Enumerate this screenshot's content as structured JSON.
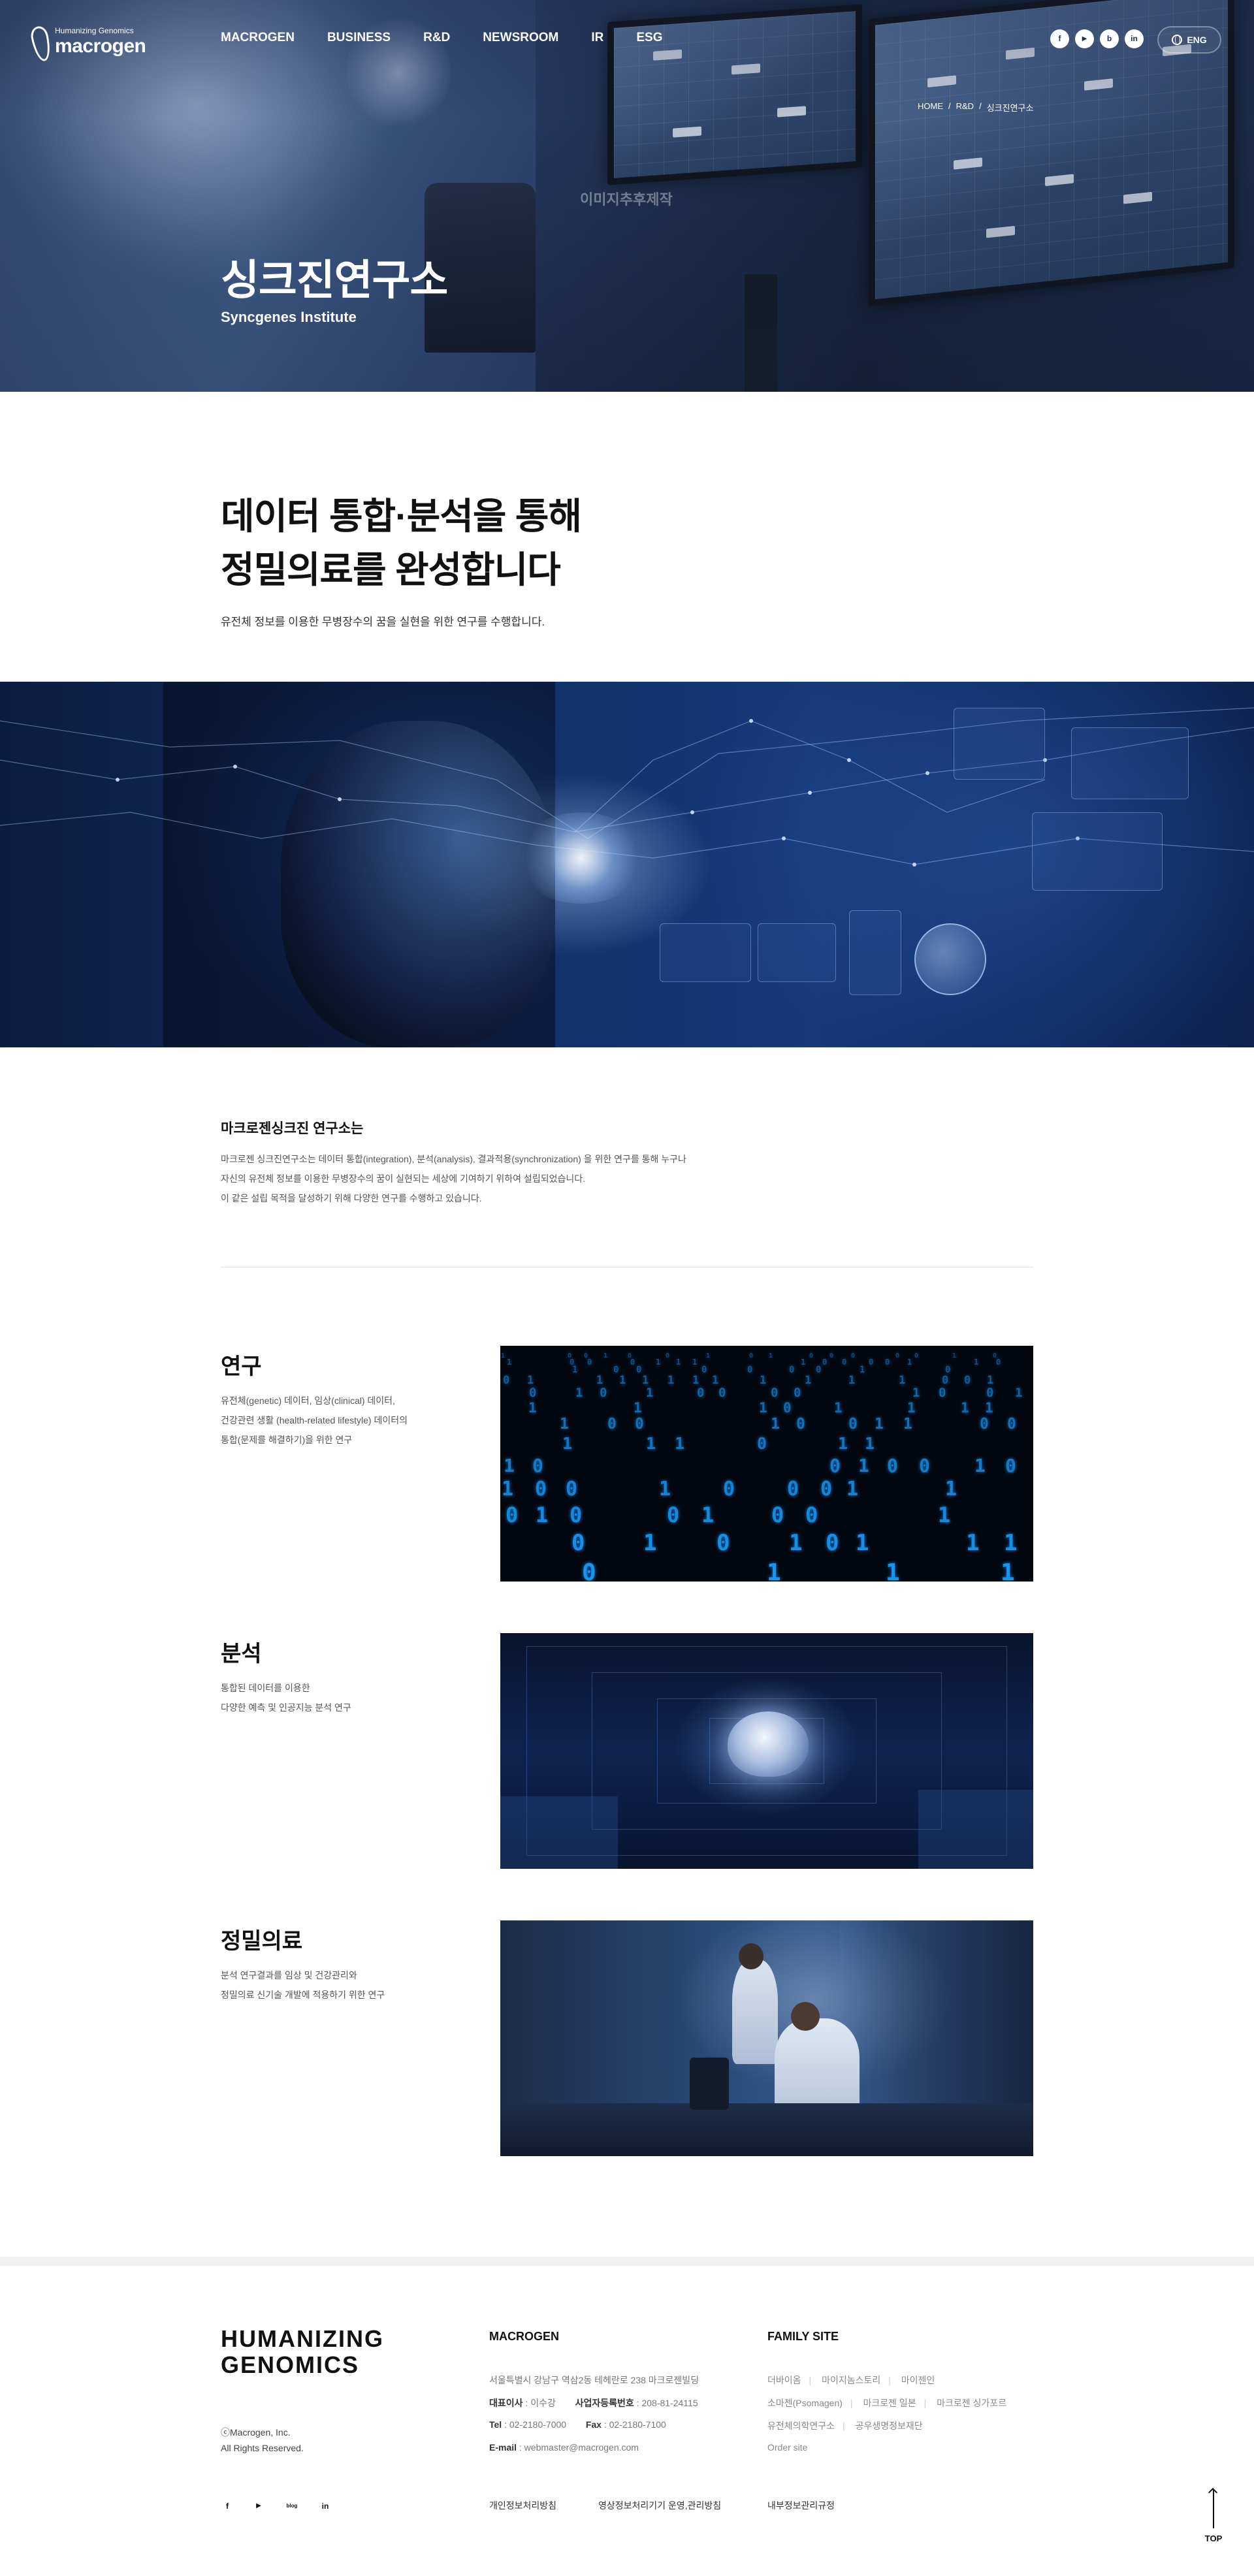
{
  "header": {
    "logo_tagline": "Humanizing Genomics",
    "logo_name": "macrogen",
    "nav": [
      "MACROGEN",
      "BUSINESS",
      "R&D",
      "NEWSROOM",
      "IR",
      "ESG"
    ],
    "social": [
      {
        "icon": "facebook-icon",
        "glyph": "f"
      },
      {
        "icon": "youtube-icon",
        "glyph": "▶"
      },
      {
        "icon": "blog-icon",
        "glyph": "b"
      },
      {
        "icon": "linkedin-icon",
        "glyph": "in"
      }
    ],
    "lang": "ENG"
  },
  "hero": {
    "breadcrumb": [
      "HOME",
      "R&D",
      "싱크진연구소"
    ],
    "watermark": "이미지추후제작",
    "title": "싱크진연구소",
    "subtitle": "Syncgenes Institute"
  },
  "intro": {
    "heading_line1": "데이터 통합·분석을 통해",
    "heading_line2": "정밀의료를 완성합니다",
    "text": "유전체 정보를 이용한 무병장수의 꿈을 실현을 위한 연구를 수행합니다."
  },
  "about": {
    "title": "마크로젠싱크진 연구소는",
    "lines": [
      "마크로젠 싱크진연구소는 데이터 통합(integration), 분석(analysis), 결과적용(synchronization) 을 위한 연구를 통해 누구나",
      "자신의 유전체 정보를 이용한 무병장수의 꿈이 실현되는 세상에 기여하기 위하여 설립되었습니다.",
      "이 같은 설립 목적을 달성하기 위해 다양한 연구를 수행하고 있습니다."
    ]
  },
  "sections": [
    {
      "title": "연구",
      "lines": [
        "유전체(genetic) 데이터, 임상(clinical) 데이터,",
        "건강관련 생활 (health-related lifestyle) 데이터의",
        "통합(문제를 해결하기)을 위한 연구"
      ]
    },
    {
      "title": "분석",
      "lines": [
        "통합된 데이터를 이용한",
        "다양한 예측 및 인공지능 분석 연구"
      ]
    },
    {
      "title": "정밀의료",
      "lines": [
        "분석 연구결과를 임상 및 건강관리와",
        "정밀의료 신기술 개발에 적용하기 위한 연구"
      ]
    }
  ],
  "footer": {
    "brand_line1": "HUMANIZING",
    "brand_line2": "GENOMICS",
    "copyright_line1": "ⓒMacrogen, Inc.",
    "copyright_line2": "All Rights Reserved.",
    "company_title": "MACROGEN",
    "address": "서울특별시 강남구 역삼2동 테헤란로 238 마크로젠빌딩",
    "ceo_label": "대표이사",
    "ceo": " : 이수강",
    "bizno_label": "사업자등록번호",
    "bizno": " : 208-81-24115",
    "tel_label": "Tel",
    "tel": " : 02-2180-7000",
    "fax_label": "Fax",
    "fax": " : 02-2180-7100",
    "email_label": "E-mail",
    "email": " : webmaster@macrogen.com",
    "family_title": "FAMILY SITE",
    "family_row1": [
      "더바이옴",
      "마이지놈스토리",
      "마이젠인"
    ],
    "family_row2": [
      "소마젠(Psomagen)",
      "마크로젠 일본",
      "마크로젠 싱가포르"
    ],
    "family_row3": [
      "유전체의학연구소",
      "공우생명정보재단"
    ],
    "family_row4": [
      "Order site"
    ],
    "policies": [
      "개인정보처리방침",
      "영상정보처리기기 운영,관리방침",
      "내부정보관리규정"
    ],
    "social": [
      {
        "icon": "facebook-icon",
        "glyph": "f"
      },
      {
        "icon": "youtube-icon",
        "glyph": "▶"
      },
      {
        "icon": "blog-icon",
        "glyph": "blog"
      },
      {
        "icon": "linkedin-icon",
        "glyph": "in"
      }
    ],
    "top_label": "TOP"
  }
}
